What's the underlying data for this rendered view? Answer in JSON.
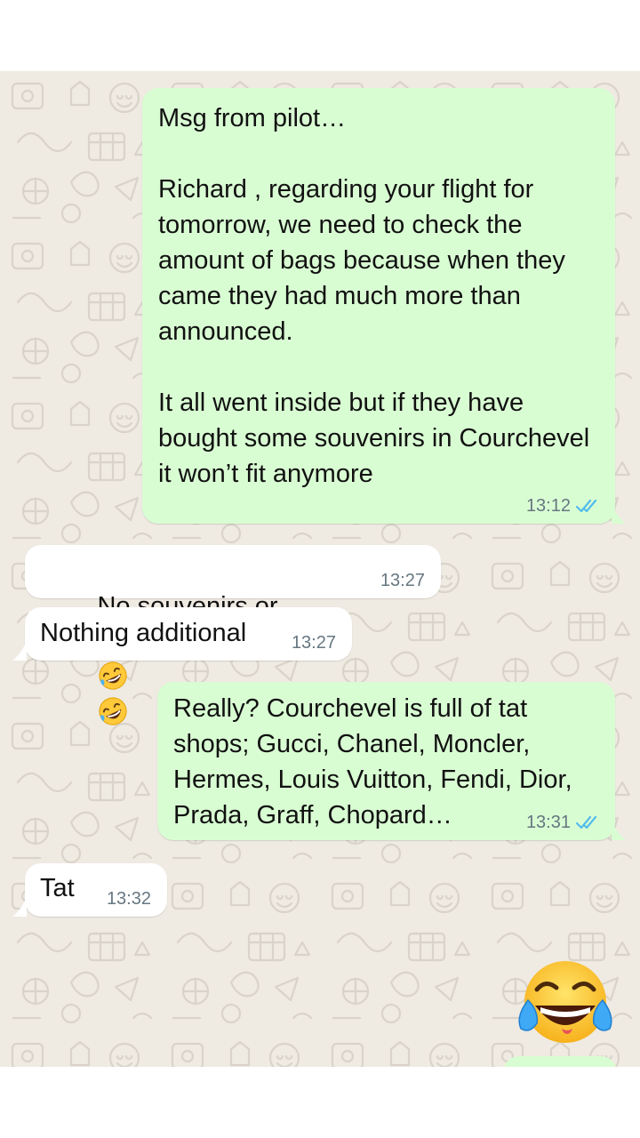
{
  "chat": {
    "messages": [
      {
        "direction": "outgoing",
        "text": "Msg from pilot…\n\nRichard , regarding your flight for tomorrow, we need to check the amount of bags because when they came they had much more than announced.\n\nIt all went inside but if they have bought some souvenirs in Courchevel it won’t fit anymore",
        "time": "13:12",
        "status": "read"
      },
      {
        "direction": "incoming",
        "text": "No souvenirs or tat",
        "emojis": [
          "rolling-on-floor-laughing",
          "rolling-on-floor-laughing"
        ],
        "time": "13:27"
      },
      {
        "direction": "incoming",
        "text": "Nothing additional",
        "time": "13:27"
      },
      {
        "direction": "outgoing",
        "text": "Really? Courchevel is full of tat shops; Gucci, Chanel, Moncler, Hermes, Louis Vuitton, Fendi, Dior, Prada, Graff, Chopard…",
        "time": "13:31",
        "status": "read"
      },
      {
        "direction": "incoming",
        "text": "Tat",
        "time": "13:32"
      },
      {
        "direction": "outgoing",
        "emoji": "face-with-tears-of-joy"
      }
    ]
  },
  "colors": {
    "outgoing_bubble": "#d9fdd3",
    "incoming_bubble": "#ffffff",
    "wallpaper": "#efeae2",
    "read_ticks": "#53bdeb",
    "time_text": "#667781"
  }
}
